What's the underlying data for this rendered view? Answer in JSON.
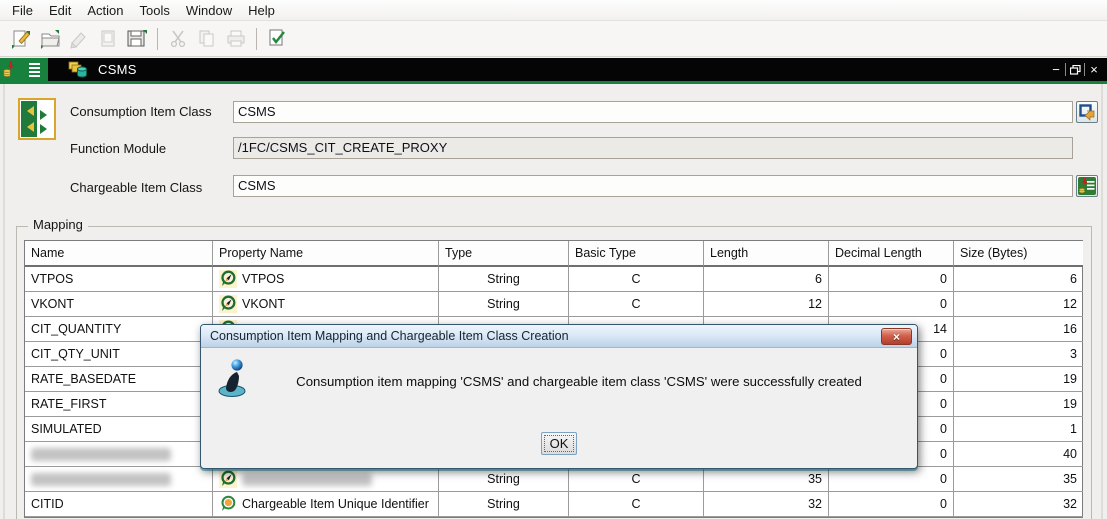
{
  "window": {
    "title": "CSMS",
    "controls": {
      "minimize": "−",
      "restore": "restore",
      "close": "×"
    }
  },
  "menu": {
    "items": [
      "File",
      "Edit",
      "Action",
      "Tools",
      "Window",
      "Help"
    ]
  },
  "toolbar": {
    "icons": [
      {
        "name": "create",
        "enabled": true
      },
      {
        "name": "open",
        "enabled": true
      },
      {
        "name": "edit",
        "enabled": false
      },
      {
        "name": "display",
        "enabled": false
      },
      {
        "name": "save",
        "enabled": true
      },
      {
        "name": "cut",
        "enabled": false
      },
      {
        "name": "copy",
        "enabled": false
      },
      {
        "name": "print",
        "enabled": false
      },
      {
        "name": "check",
        "enabled": true
      }
    ]
  },
  "form": {
    "consumption_item_class": {
      "label": "Consumption Item Class",
      "value": "CSMS"
    },
    "function_module": {
      "label": "Function Module",
      "value": "/1FC/CSMS_CIT_CREATE_PROXY"
    },
    "chargeable_item_class": {
      "label": "Chargeable Item Class",
      "value": "CSMS"
    }
  },
  "mapping": {
    "group_label": "Mapping",
    "columns": [
      "Name",
      "Property Name",
      "Type",
      "Basic Type",
      "Length",
      "Decimal Length",
      "Size (Bytes)"
    ],
    "rows": [
      {
        "name": "VTPOS",
        "icon": "compass",
        "property": "VTPOS",
        "type": "String",
        "basic_type": "C",
        "length": "6",
        "decimal_length": "0",
        "size": "6"
      },
      {
        "name": "VKONT",
        "icon": "compass",
        "property": "VKONT",
        "type": "String",
        "basic_type": "C",
        "length": "12",
        "decimal_length": "0",
        "size": "12"
      },
      {
        "name": "CIT_QUANTITY",
        "icon": "compass",
        "property": "",
        "type": "",
        "basic_type": "",
        "length": "",
        "decimal_length": "14",
        "size": "16"
      },
      {
        "name": "CIT_QTY_UNIT",
        "icon": "compass",
        "property": "",
        "type": "",
        "basic_type": "",
        "length": "",
        "decimal_length": "0",
        "size": "3"
      },
      {
        "name": "RATE_BASEDATE",
        "icon": "compass",
        "property": "",
        "type": "",
        "basic_type": "",
        "length": "",
        "decimal_length": "0",
        "size": "19"
      },
      {
        "name": "RATE_FIRST",
        "icon": "compass",
        "property": "",
        "type": "",
        "basic_type": "",
        "length": "",
        "decimal_length": "0",
        "size": "19"
      },
      {
        "name": "SIMULATED",
        "icon": "compass",
        "property": "",
        "type": "",
        "basic_type": "",
        "length": "",
        "decimal_length": "0",
        "size": "1"
      },
      {
        "name": "",
        "name_redacted": true,
        "icon": "compass",
        "property": "",
        "type": "",
        "basic_type": "",
        "length": "",
        "decimal_length": "0",
        "size": "40"
      },
      {
        "name": "",
        "name_redacted": true,
        "icon": "compass",
        "property": "",
        "property_redacted": true,
        "type": "String",
        "basic_type": "C",
        "length": "35",
        "decimal_length": "0",
        "size": "35"
      },
      {
        "name": "CITID",
        "icon": "circle",
        "property": "Chargeable Item Unique Identifier",
        "type": "String",
        "basic_type": "C",
        "length": "32",
        "decimal_length": "0",
        "size": "32"
      }
    ]
  },
  "dialog": {
    "title": "Consumption Item Mapping and Chargeable Item Class Creation",
    "message": "Consumption item mapping 'CSMS' and chargeable item class 'CSMS' were successfully created",
    "ok_label": "OK",
    "close_icon": "×",
    "info_icon": "info"
  },
  "colors": {
    "titlebar_green": "#17813d",
    "titlebar_black": "#050505",
    "dialog_title_top": "#dce9f7",
    "dialog_title_bottom": "#bcd2e8",
    "close_button_red": "#c0492e",
    "table_grid": "#9b9b9b"
  }
}
